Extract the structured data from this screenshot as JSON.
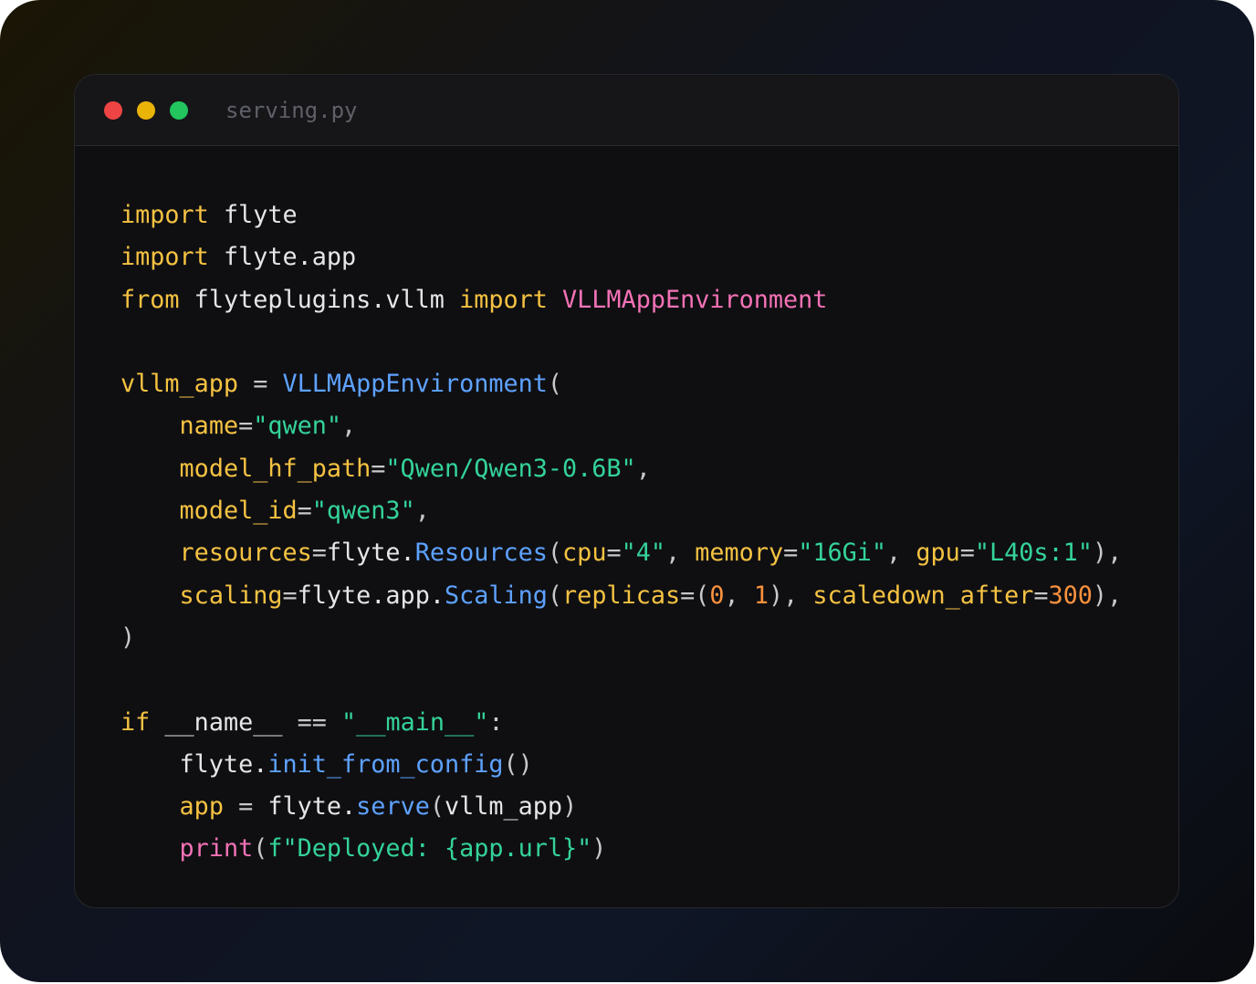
{
  "window": {
    "filename": "serving.py",
    "buttons": {
      "close": "close",
      "minimize": "minimize",
      "maximize": "maximize"
    }
  },
  "colors": {
    "keyword": "#f5c242",
    "identifier": "#e6e6e6",
    "class_import": "#f472b6",
    "call": "#5ea2ff",
    "string": "#34d399",
    "number": "#fb923c",
    "punctuation": "#c8c8c8",
    "close_dot": "#ef4444",
    "minimize_dot": "#eab308",
    "maximize_dot": "#22c55e"
  },
  "code": {
    "lines": [
      [
        [
          "kw",
          "import"
        ],
        [
          "id",
          " flyte"
        ]
      ],
      [
        [
          "kw",
          "import"
        ],
        [
          "id",
          " flyte.app"
        ]
      ],
      [
        [
          "kw",
          "from"
        ],
        [
          "id",
          " flyteplugins.vllm "
        ],
        [
          "kw",
          "import"
        ],
        [
          "id",
          " "
        ],
        [
          "cls",
          "VLLMAppEnvironment"
        ]
      ],
      [],
      [
        [
          "var",
          "vllm_app"
        ],
        [
          "op",
          " = "
        ],
        [
          "call",
          "VLLMAppEnvironment"
        ],
        [
          "punc",
          "("
        ]
      ],
      [
        [
          "id",
          "    "
        ],
        [
          "var",
          "name"
        ],
        [
          "op",
          "="
        ],
        [
          "str",
          "\"qwen\""
        ],
        [
          "punc",
          ","
        ]
      ],
      [
        [
          "id",
          "    "
        ],
        [
          "var",
          "model_hf_path"
        ],
        [
          "op",
          "="
        ],
        [
          "str",
          "\"Qwen/Qwen3-0.6B\""
        ],
        [
          "punc",
          ","
        ]
      ],
      [
        [
          "id",
          "    "
        ],
        [
          "var",
          "model_id"
        ],
        [
          "op",
          "="
        ],
        [
          "str",
          "\"qwen3\""
        ],
        [
          "punc",
          ","
        ]
      ],
      [
        [
          "id",
          "    "
        ],
        [
          "var",
          "resources"
        ],
        [
          "op",
          "="
        ],
        [
          "id",
          "flyte."
        ],
        [
          "call",
          "Resources"
        ],
        [
          "punc",
          "("
        ],
        [
          "var",
          "cpu"
        ],
        [
          "op",
          "="
        ],
        [
          "str",
          "\"4\""
        ],
        [
          "punc",
          ", "
        ],
        [
          "var",
          "memory"
        ],
        [
          "op",
          "="
        ],
        [
          "str",
          "\"16Gi\""
        ],
        [
          "punc",
          ", "
        ],
        [
          "var",
          "gpu"
        ],
        [
          "op",
          "="
        ],
        [
          "str",
          "\"L40s:1\""
        ],
        [
          "punc",
          "),"
        ]
      ],
      [
        [
          "id",
          "    "
        ],
        [
          "var",
          "scaling"
        ],
        [
          "op",
          "="
        ],
        [
          "id",
          "flyte.app."
        ],
        [
          "call",
          "Scaling"
        ],
        [
          "punc",
          "("
        ],
        [
          "var",
          "replicas"
        ],
        [
          "op",
          "="
        ],
        [
          "punc",
          "("
        ],
        [
          "num",
          "0"
        ],
        [
          "punc",
          ", "
        ],
        [
          "num",
          "1"
        ],
        [
          "punc",
          "), "
        ],
        [
          "var",
          "scaledown_after"
        ],
        [
          "op",
          "="
        ],
        [
          "num",
          "300"
        ],
        [
          "punc",
          "),"
        ]
      ],
      [
        [
          "punc",
          ")"
        ]
      ],
      [],
      [
        [
          "kw",
          "if"
        ],
        [
          "id",
          " __name__ "
        ],
        [
          "op",
          "=="
        ],
        [
          "id",
          " "
        ],
        [
          "str",
          "\"__main__\""
        ],
        [
          "punc",
          ":"
        ]
      ],
      [
        [
          "id",
          "    flyte."
        ],
        [
          "call",
          "init_from_config"
        ],
        [
          "punc",
          "()"
        ]
      ],
      [
        [
          "id",
          "    "
        ],
        [
          "var",
          "app"
        ],
        [
          "op",
          " = "
        ],
        [
          "id",
          "flyte."
        ],
        [
          "call",
          "serve"
        ],
        [
          "punc",
          "("
        ],
        [
          "id",
          "vllm_app"
        ],
        [
          "punc",
          ")"
        ]
      ],
      [
        [
          "id",
          "    "
        ],
        [
          "builtin",
          "print"
        ],
        [
          "punc",
          "("
        ],
        [
          "str",
          "f\"Deployed: {app.url}\""
        ],
        [
          "punc",
          ")"
        ]
      ]
    ]
  }
}
